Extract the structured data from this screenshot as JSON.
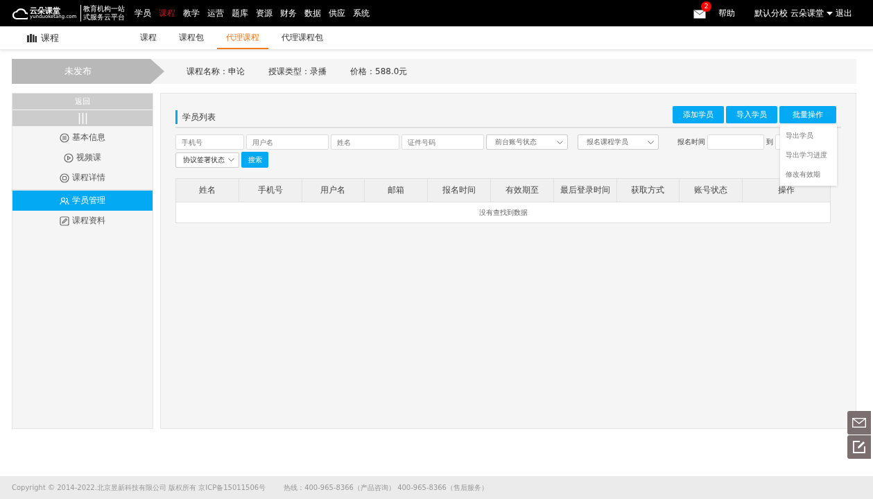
{
  "top_nav": {
    "logo": {
      "name": "云朵课堂",
      "url": "yunduoketang.com",
      "slogan": [
        "教育机构一站",
        "式服务云平台"
      ]
    },
    "menu": [
      {
        "label": "学员",
        "selected": false
      },
      {
        "label": "课程",
        "selected": true
      },
      {
        "label": "教学",
        "selected": false
      },
      {
        "label": "运营",
        "selected": false
      },
      {
        "label": "题库",
        "selected": false
      },
      {
        "label": "资源",
        "selected": false
      },
      {
        "label": "财务",
        "selected": false
      },
      {
        "label": "数据",
        "selected": false
      },
      {
        "label": "供应",
        "selected": false
      },
      {
        "label": "系统",
        "selected": false
      }
    ],
    "messages_badge": "2",
    "help": "帮助",
    "school": "默认分校",
    "user": "云朵课堂",
    "logout": "退出"
  },
  "sub_nav": {
    "title": "课程",
    "tabs": [
      {
        "label": "课程",
        "selected": false
      },
      {
        "label": "课程包",
        "selected": false
      },
      {
        "label": "代理课程",
        "selected": true
      },
      {
        "label": "代理课程包",
        "selected": false
      }
    ]
  },
  "course_bar": {
    "status": "未发布",
    "fields": [
      {
        "label": "课程名称：",
        "value": "申论"
      },
      {
        "label": "授课类型：",
        "value": "录播"
      },
      {
        "label": "价格：",
        "value": "588.0元"
      }
    ]
  },
  "sidebar": {
    "back": "返回",
    "groups": [
      [
        {
          "label": "基本信息",
          "selected": false
        },
        {
          "label": "视频课",
          "selected": false
        },
        {
          "label": "课程详情",
          "selected": false
        }
      ],
      [
        {
          "label": "学员管理",
          "selected": true
        },
        {
          "label": "课程资料",
          "selected": false
        }
      ]
    ]
  },
  "main": {
    "title": "学员列表",
    "buttons": [
      "添加学员",
      "导入学员",
      "批量操作"
    ],
    "batch_menu": [
      "导出学员",
      "导出学习进度",
      "修改有效期"
    ],
    "filters": [
      {
        "kind": "input",
        "placeholder": "手机号"
      },
      {
        "kind": "input",
        "placeholder": "用户名"
      },
      {
        "kind": "input",
        "placeholder": "姓名"
      },
      {
        "kind": "input",
        "placeholder": "证件号码"
      },
      {
        "kind": "select",
        "value": "前台账号状态"
      },
      {
        "kind": "select",
        "value": "报名课程学员"
      },
      {
        "kind": "date_range",
        "label": "报名时间",
        "separator": "到"
      },
      {
        "kind": "select",
        "value": "协议签署状态"
      },
      {
        "kind": "button",
        "label": "搜索"
      }
    ],
    "table": {
      "columns": [
        "姓名",
        "手机号",
        "用户名",
        "邮箱",
        "报名时间",
        "有效期至",
        "最后登录时间",
        "获取方式",
        "账号状态",
        "操作"
      ],
      "empty_text": "没有查找到数据"
    }
  },
  "footer": {
    "copyright": "Copyright © 2014-2022.北京昱新科技有限公司 版权所有 京ICP备15011506号",
    "hotline": "热线：400-965-8366（产品咨询） 400-965-8366（售后服务）"
  }
}
